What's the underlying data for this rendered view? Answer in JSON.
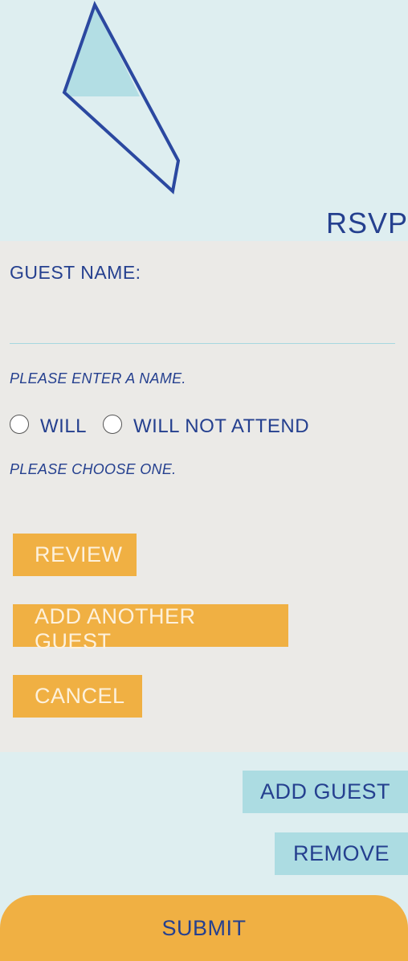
{
  "header": {
    "title": "RSVP"
  },
  "form": {
    "guest_name_label": "GUEST NAME:",
    "guest_name_value": "",
    "name_error": "PLEASE ENTER A NAME.",
    "attendance_options": [
      "WILL",
      "WILL NOT ATTEND"
    ],
    "choice_error": "PLEASE CHOOSE ONE.",
    "review_label": "REVIEW",
    "add_another_label": "ADD ANOTHER GUEST",
    "cancel_label": "CANCEL"
  },
  "actions": {
    "add_guest_label": "ADD GUEST",
    "remove_label": "REMOVE",
    "submit_label": "SUBMIT"
  },
  "colors": {
    "navy": "#25408f",
    "orange": "#f0b043",
    "light_blue": "#acdce2",
    "background": "#deeef0",
    "panel": "#ebeae7"
  },
  "icons": {
    "decoration": "geometric-shape-icon"
  }
}
